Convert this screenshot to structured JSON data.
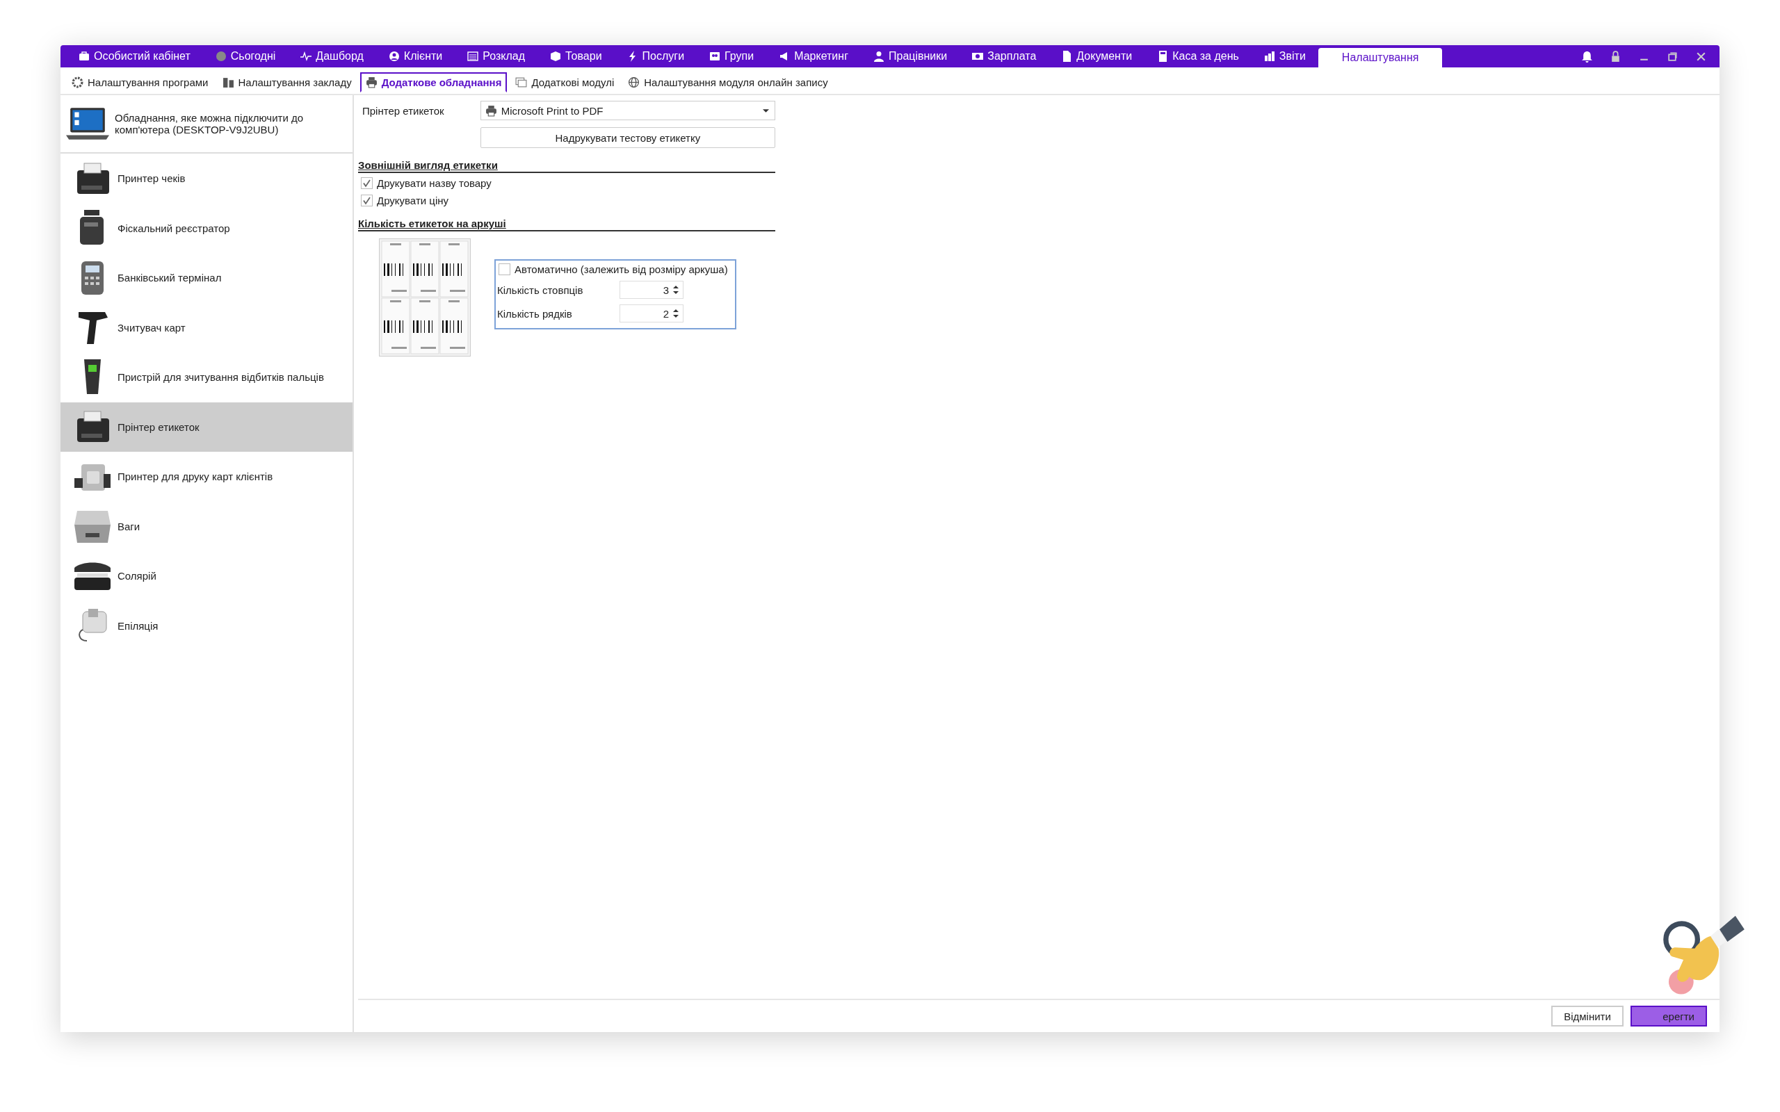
{
  "nav": [
    {
      "label": "Особистий кабінет",
      "selected": false
    },
    {
      "label": "Сьогодні",
      "selected": false
    },
    {
      "label": "Дашборд",
      "selected": false
    },
    {
      "label": "Клієнти",
      "selected": false
    },
    {
      "label": "Розклад",
      "selected": false
    },
    {
      "label": "Товари",
      "selected": false
    },
    {
      "label": "Послуги",
      "selected": false
    },
    {
      "label": "Групи",
      "selected": false
    },
    {
      "label": "Маркетинг",
      "selected": false
    },
    {
      "label": "Працівники",
      "selected": false
    },
    {
      "label": "Зарплата",
      "selected": false
    },
    {
      "label": "Документи",
      "selected": false
    },
    {
      "label": "Каса за день",
      "selected": false
    },
    {
      "label": "Звіти",
      "selected": false
    },
    {
      "label": "Налаштування",
      "selected": true
    }
  ],
  "subtabs": [
    {
      "label": "Налаштування програми",
      "selected": false
    },
    {
      "label": "Налаштування закладу",
      "selected": false
    },
    {
      "label": "Додаткове обладнання",
      "selected": true
    },
    {
      "label": "Додаткові модулі",
      "selected": false
    },
    {
      "label": "Налаштування модуля онлайн запису",
      "selected": false
    }
  ],
  "sidebar": {
    "header": "Обладнання, яке можна підключити до комп'ютера (DESKTOP-V9J2UBU)",
    "items": [
      {
        "label": "Принтер чеків",
        "selected": false
      },
      {
        "label": "Фіскальний реєстратор",
        "selected": false
      },
      {
        "label": "Банківський термінал",
        "selected": false
      },
      {
        "label": "Зчитувач карт",
        "selected": false
      },
      {
        "label": "Пристрій для зчитування відбитків пальців",
        "selected": false
      },
      {
        "label": "Прінтер етикеток",
        "selected": true
      },
      {
        "label": "Принтер для друку карт клієнтів",
        "selected": false
      },
      {
        "label": "Ваги",
        "selected": false
      },
      {
        "label": "Солярій",
        "selected": false
      },
      {
        "label": "Епіляція",
        "selected": false
      }
    ]
  },
  "printer": {
    "label": "Прінтер етикеток",
    "value": "Microsoft Print to PDF"
  },
  "test_button": "Надрукувати тестову етикетку",
  "appearance": {
    "title": "Зовнішній вигляд етикетки",
    "options": [
      {
        "label": "Друкувати назву товару",
        "checked": true
      },
      {
        "label": "Друкувати ціну",
        "checked": true
      }
    ]
  },
  "count": {
    "title": "Кількість етикеток на аркуші",
    "auto": {
      "label": "Автоматично (залежить від розміру аркуша)",
      "checked": false
    },
    "fields": [
      {
        "label": "Кількість стовпців",
        "value": "3"
      },
      {
        "label": "Кількість рядків",
        "value": "2"
      }
    ]
  },
  "buttons": [
    {
      "label": "Відмінити",
      "kind": "secondary"
    },
    {
      "label": "ерегти",
      "kind": "primary"
    }
  ]
}
